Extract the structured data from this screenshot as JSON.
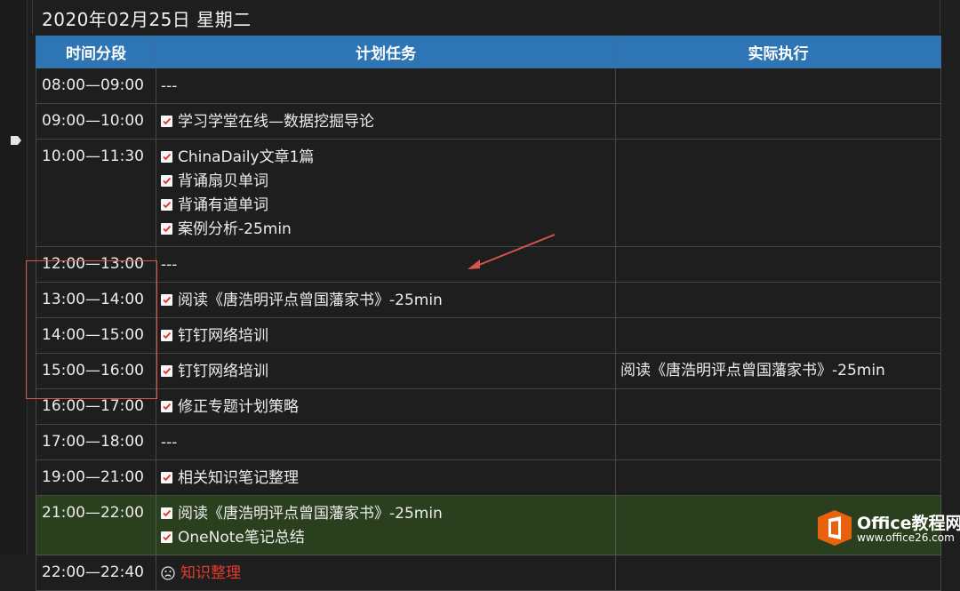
{
  "page": {
    "date_title": "2020年02月25日 星期二"
  },
  "table": {
    "headers": [
      "时间分段",
      "计划任务",
      "实际执行"
    ],
    "rows": [
      {
        "time": "08:00—09:00",
        "tasks": [
          {
            "text": "---",
            "mark": "none"
          }
        ],
        "actual": ""
      },
      {
        "time": "09:00—10:00",
        "tasks": [
          {
            "text": "学习学堂在线—数据挖掘导论",
            "mark": "check"
          }
        ],
        "actual": ""
      },
      {
        "time": "10:00—11:30",
        "tasks": [
          {
            "text": "ChinaDaily文章1篇",
            "mark": "check"
          },
          {
            "text": "背诵扇贝单词",
            "mark": "check"
          },
          {
            "text": "背诵有道单词",
            "mark": "check"
          },
          {
            "text": "案例分析-25min",
            "mark": "check"
          }
        ],
        "actual": ""
      },
      {
        "time": "12:00—13:00",
        "tasks": [
          {
            "text": "---",
            "mark": "none"
          }
        ],
        "actual": ""
      },
      {
        "time": "13:00—14:00",
        "tasks": [
          {
            "text": "阅读《唐浩明评点曾国藩家书》-25min",
            "mark": "check"
          }
        ],
        "actual": ""
      },
      {
        "time": "14:00—15:00",
        "tasks": [
          {
            "text": "钉钉网络培训",
            "mark": "check"
          }
        ],
        "actual": ""
      },
      {
        "time": "15:00—16:00",
        "tasks": [
          {
            "text": "钉钉网络培训",
            "mark": "check"
          }
        ],
        "actual": "阅读《唐浩明评点曾国藩家书》-25min"
      },
      {
        "time": "16:00—17:00",
        "tasks": [
          {
            "text": "修正专题计划策略",
            "mark": "check"
          }
        ],
        "actual": ""
      },
      {
        "time": "17:00—18:00",
        "tasks": [
          {
            "text": "---",
            "mark": "none"
          }
        ],
        "actual": ""
      },
      {
        "time": "19:00—21:00",
        "tasks": [
          {
            "text": "相关知识笔记整理",
            "mark": "check"
          }
        ],
        "actual": ""
      },
      {
        "time": "21:00—22:00",
        "highlight": "green",
        "tasks": [
          {
            "text": "阅读《唐浩明评点曾国藩家书》-25min",
            "mark": "check"
          },
          {
            "text": "OneNote笔记总结",
            "mark": "check"
          }
        ],
        "actual": ""
      },
      {
        "time": "22:00—22:40",
        "tasks": [
          {
            "text": "知识整理",
            "mark": "sad",
            "color": "red"
          }
        ],
        "actual": ""
      }
    ]
  },
  "colors": {
    "header_bg": "#2e75b6",
    "highlight_green": "#2a3f1e",
    "annotation_red": "#d9534f",
    "background": "#1e1e1e"
  },
  "icons": {
    "done_task": "checked-checkbox-icon",
    "unfinished_task": "sad-face-icon",
    "section_marker": "page-marker-icon"
  },
  "watermark": {
    "title": "Office教程网",
    "url": "www.office26.com"
  }
}
